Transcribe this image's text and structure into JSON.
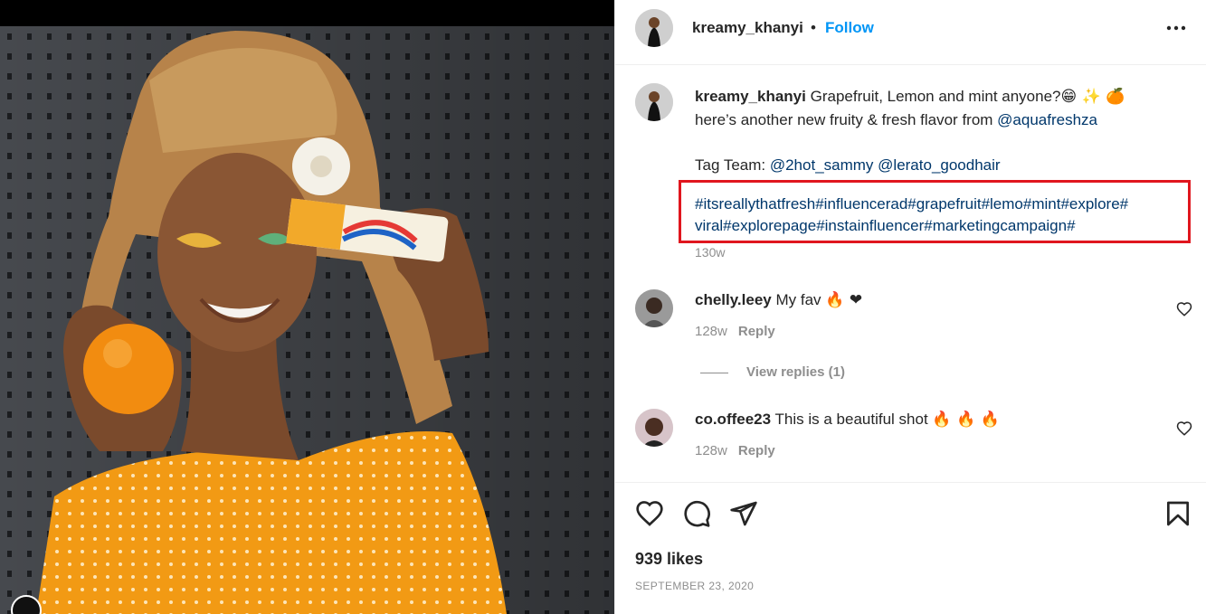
{
  "post": {
    "username": "kreamy_khanyi",
    "separator": "•",
    "follow_label": "Follow",
    "caption": {
      "line1": "Grapefruit, Lemon and mint anyone?",
      "line1_emojis": "😁 ✨ 🍊",
      "line2_prefix": "here’s another new fruity & fresh flavor from ",
      "line2_mention": "@aquafreshza",
      "tag_team_label": "Tag Team: ",
      "tag_mention_1": "@2hot_sammy",
      "tag_mention_2": "@lerato_goodhair",
      "hashtags_line1": "#itsreallythatfresh#influencerad#grapefruit#lemo#mint#explore#",
      "hashtags_line2": "viral#explorepage#instainfluencer#marketingcampaign#",
      "time": "130w"
    }
  },
  "comments": [
    {
      "username": "chelly.leey",
      "text": "My fav",
      "emojis": "🔥 ❤",
      "time": "128w",
      "reply_label": "Reply"
    },
    {
      "username": "co.offee23",
      "text": "This is a beautiful shot",
      "emojis": "🔥 🔥 🔥",
      "time": "128w",
      "reply_label": "Reply"
    }
  ],
  "view_replies_label": "View replies (1)",
  "likes_text": "939 likes",
  "date_text": "SEPTEMBER 23, 2020",
  "colors": {
    "follow": "#0095f6",
    "link": "#00376b",
    "highlight_box": "#e0161e",
    "muted": "#8e8e8e"
  },
  "icons": [
    "more-options-icon",
    "heart-icon",
    "comment-icon",
    "share-icon",
    "bookmark-icon",
    "small-heart-icon"
  ]
}
